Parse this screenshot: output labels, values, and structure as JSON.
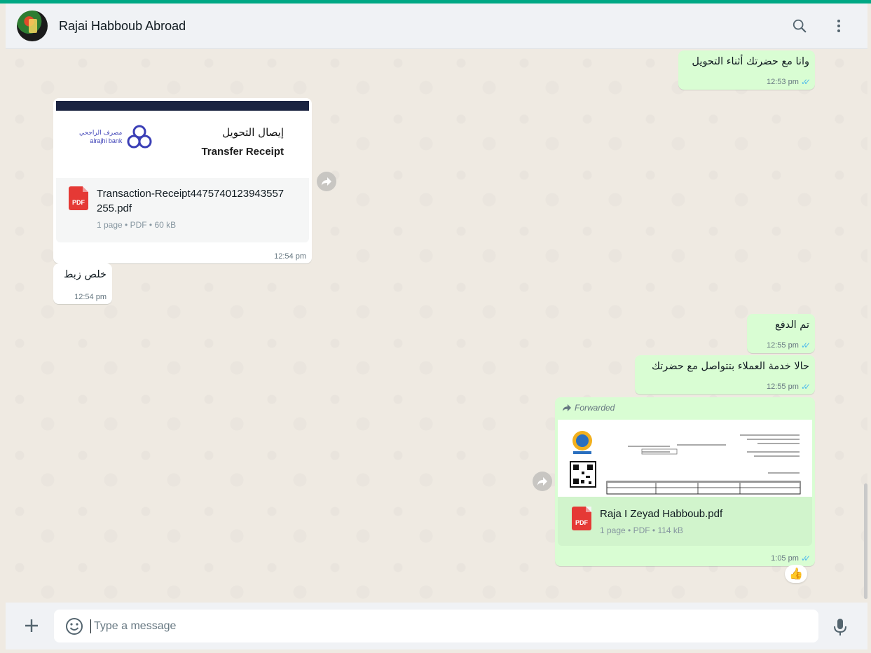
{
  "header": {
    "contact_name": "Rajai Habboub Abroad",
    "icons": [
      "search-icon",
      "menu-icon"
    ]
  },
  "messages": {
    "m1": {
      "text": "وانا مع حضرتك أثناء التحويل",
      "time": "12:53 pm",
      "status": "read"
    },
    "m2": {
      "preview_title_ar": "إيصال التحويل",
      "preview_title_en": "Transfer Receipt",
      "bank_logo_text_ar": "مصرف الراجحي",
      "bank_logo_text_en": "alrajhi bank",
      "file_name": "Transaction-Receipt4475740123943557255.pdf",
      "file_meta": "1 page • PDF • 60 kB",
      "file_type": "PDF",
      "time": "12:54 pm"
    },
    "m3": {
      "text": "خلص زبط",
      "time": "12:54 pm"
    },
    "m4": {
      "text": "تم الدفع",
      "time": "12:55 pm",
      "status": "read"
    },
    "m5": {
      "text": "حالا خدمة العملاء بتتواصل مع حضرتك",
      "time": "12:55 pm",
      "status": "read"
    },
    "m6": {
      "forwarded_label": "Forwarded",
      "file_name": "Raja I Zeyad Habboub.pdf",
      "file_meta": "1 page • PDF • 114 kB",
      "file_type": "PDF",
      "time": "1:05 pm",
      "status": "read",
      "reaction": "👍"
    }
  },
  "composer": {
    "placeholder": "Type a message"
  },
  "colors": {
    "accent": "#00a884",
    "outgoing_bubble": "#d9fdd3",
    "incoming_bubble": "#ffffff",
    "chat_background": "#efeae2",
    "read_ticks": "#53bdeb",
    "pdf_icon": "#e53935"
  }
}
